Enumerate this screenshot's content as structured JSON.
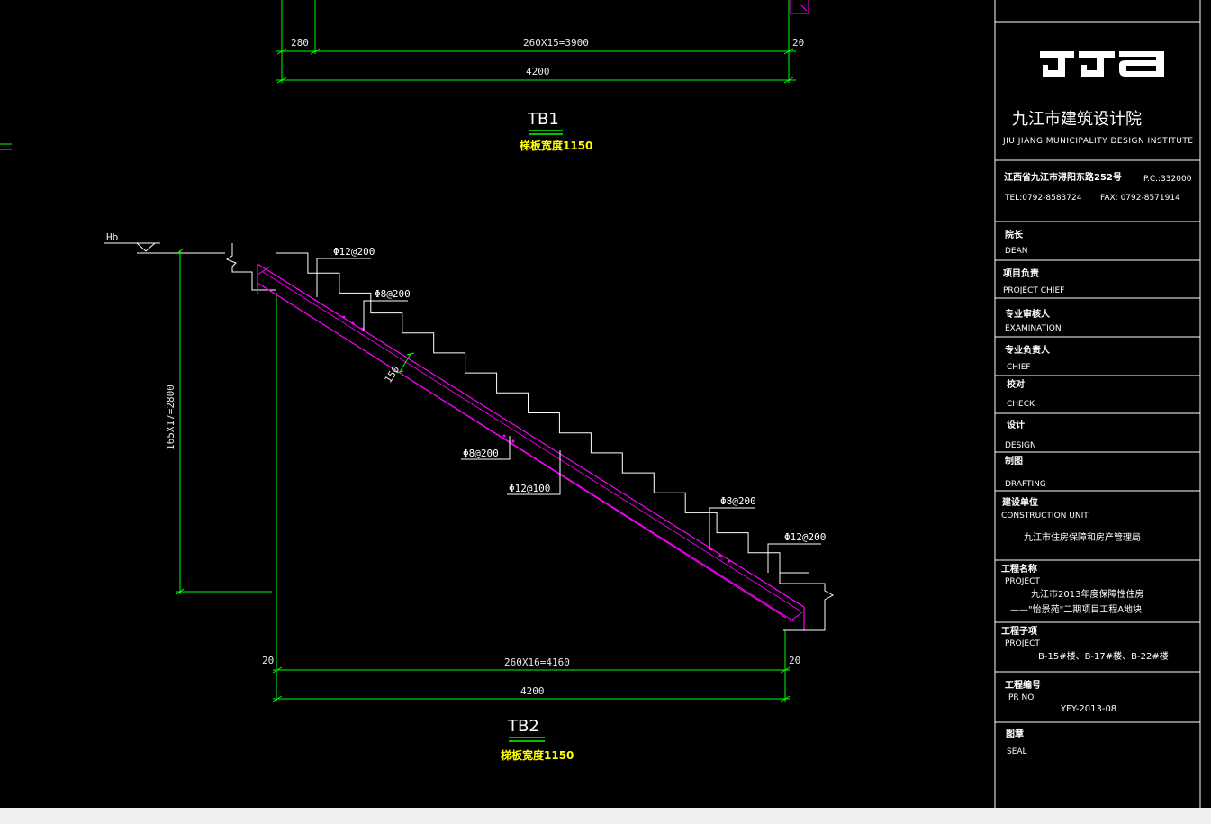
{
  "tb1": {
    "title": "TB1",
    "width_note": "梯板宽度1150",
    "dims": {
      "left": "280",
      "middle": "260X15=3900",
      "right": "20",
      "total": "4200"
    }
  },
  "tb2": {
    "title": "TB2",
    "width_note": "梯板宽度1150",
    "level_mark": "Hb",
    "thickness": "150",
    "vertical_dim": "165X17=2800",
    "dims": {
      "left": "20",
      "middle": "260X16=4160",
      "right": "20",
      "total": "4200"
    },
    "rebar_labels": [
      "Φ12@200",
      "Φ8@200",
      "Φ8@200",
      "Φ12@100",
      "Φ8@200",
      "Φ12@200"
    ]
  },
  "title_block": {
    "institute_cn": "九江市建筑设计院",
    "institute_en": "JIU JIANG MUNICIPALITY DESIGN INSTITUTE",
    "address": "江西省九江市浔阳东路252号",
    "postcode": "P.C.:332000",
    "tel": "TEL:0792-8583724",
    "fax": "FAX: 0792-8571914",
    "rows": [
      {
        "cn": "院长",
        "en": "DEAN"
      },
      {
        "cn": "项目负责",
        "en": "PROJECT CHIEF"
      },
      {
        "cn": "专业审核人",
        "en": "EXAMINATION"
      },
      {
        "cn": "专业负责人",
        "en": "CHIEF"
      },
      {
        "cn": "校对",
        "en": "CHECK"
      },
      {
        "cn": "设计",
        "en": "DESIGN"
      },
      {
        "cn": "制图",
        "en": "DRAFTING"
      }
    ],
    "construction_unit": {
      "cn": "建设单位",
      "en": "CONSTRUCTION UNIT",
      "value": "九江市住房保障和房产管理局"
    },
    "project": {
      "cn": "工程名称",
      "en": "PROJECT",
      "value1": "九江市2013年度保障性住房",
      "value2": "——\"怡景苑\"二期项目工程A地块"
    },
    "sub_project": {
      "cn": "工程子项",
      "en": "PROJECT",
      "value": "B-15#楼、B-17#楼、B-22#楼"
    },
    "project_no": {
      "cn": "工程编号",
      "en": "PR NO.",
      "value": "YFY-2013-08"
    },
    "seal": {
      "cn": "图章",
      "en": "SEAL"
    }
  },
  "colors": {
    "background": "#000000",
    "dimension": "#00ff00",
    "rebar": "#ff00ff",
    "annotation": "#ffff00",
    "line": "#ffffff"
  }
}
